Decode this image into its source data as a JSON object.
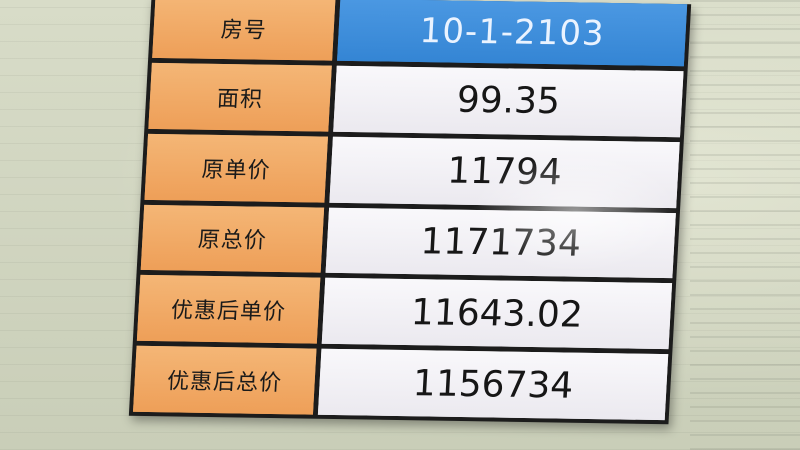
{
  "price_table": {
    "rows": [
      {
        "label": "房号",
        "value": "10-1-2103"
      },
      {
        "label": "面积",
        "value": "99.35"
      },
      {
        "label": "原单价",
        "value": "11794"
      },
      {
        "label": "原总价",
        "value": "1171734"
      },
      {
        "label": "优惠后单价",
        "value": "11643.02"
      },
      {
        "label": "优惠后总价",
        "value": "1156734"
      }
    ]
  },
  "colors": {
    "label_background": "#f1aa66",
    "value_background": "#f4f2f6",
    "highlight_background": "#3f8fdc",
    "border": "#1c1c1c"
  }
}
